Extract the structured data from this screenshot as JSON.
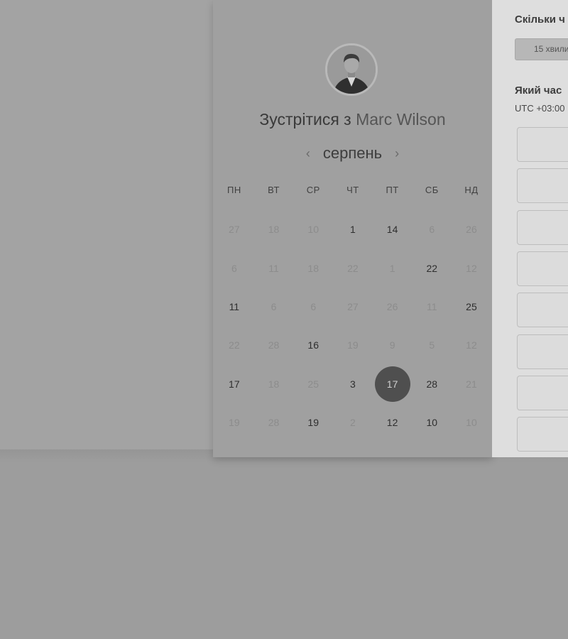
{
  "meeting": {
    "title_prefix": "Зустрітися з",
    "host_name": "Marc Wilson"
  },
  "calendar": {
    "month": "серпень",
    "prev_icon": "chevron-left-icon",
    "next_icon": "chevron-right-icon",
    "weekdays": [
      "ПН",
      "ВТ",
      "СР",
      "ЧТ",
      "ПТ",
      "СБ",
      "НД"
    ],
    "weeks": [
      [
        {
          "d": "27",
          "on": false
        },
        {
          "d": "18",
          "on": false
        },
        {
          "d": "10",
          "on": false
        },
        {
          "d": "1",
          "on": true
        },
        {
          "d": "14",
          "on": true
        },
        {
          "d": "6",
          "on": false
        },
        {
          "d": "26",
          "on": false
        }
      ],
      [
        {
          "d": "6",
          "on": false
        },
        {
          "d": "11",
          "on": false
        },
        {
          "d": "18",
          "on": false
        },
        {
          "d": "22",
          "on": false
        },
        {
          "d": "1",
          "on": false
        },
        {
          "d": "22",
          "on": true
        },
        {
          "d": "12",
          "on": false
        }
      ],
      [
        {
          "d": "11",
          "on": true
        },
        {
          "d": "6",
          "on": false
        },
        {
          "d": "6",
          "on": false
        },
        {
          "d": "27",
          "on": false
        },
        {
          "d": "26",
          "on": false
        },
        {
          "d": "11",
          "on": false
        },
        {
          "d": "25",
          "on": true
        }
      ],
      [
        {
          "d": "22",
          "on": false
        },
        {
          "d": "28",
          "on": false
        },
        {
          "d": "16",
          "on": true
        },
        {
          "d": "19",
          "on": false
        },
        {
          "d": "9",
          "on": false
        },
        {
          "d": "5",
          "on": false
        },
        {
          "d": "12",
          "on": false
        }
      ],
      [
        {
          "d": "17",
          "on": true
        },
        {
          "d": "18",
          "on": false
        },
        {
          "d": "25",
          "on": false
        },
        {
          "d": "3",
          "on": true
        },
        {
          "d": "17",
          "on": true,
          "selected": true
        },
        {
          "d": "28",
          "on": true
        },
        {
          "d": "21",
          "on": false
        }
      ],
      [
        {
          "d": "19",
          "on": false
        },
        {
          "d": "28",
          "on": false
        },
        {
          "d": "19",
          "on": true
        },
        {
          "d": "2",
          "on": false
        },
        {
          "d": "12",
          "on": true
        },
        {
          "d": "10",
          "on": true
        },
        {
          "d": "10",
          "on": false
        }
      ]
    ]
  },
  "booking": {
    "duration_title": "Скільки ч",
    "duration_value": "15 хвили",
    "time_title": "Який час",
    "timezone": "UTC +03:00",
    "slot_count": 8
  }
}
